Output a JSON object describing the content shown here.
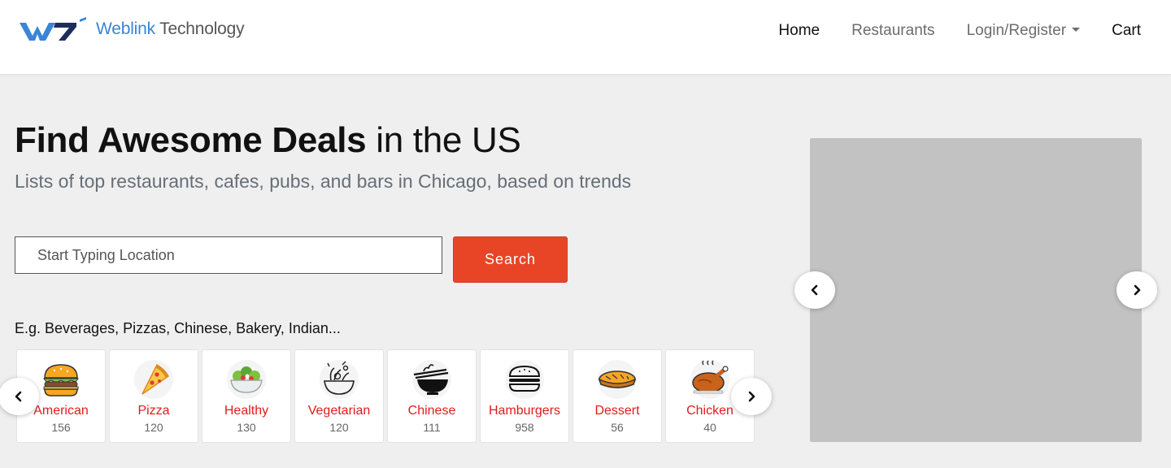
{
  "header": {
    "logo_mark": "W7",
    "logo_brand": "Weblink",
    "logo_rest": " Technology",
    "nav": {
      "home": "Home",
      "restaurants": "Restaurants",
      "login": "Login/Register",
      "cart": "Cart"
    }
  },
  "hero": {
    "title_bold": "Find Awesome Deals",
    "title_rest": " in the US",
    "subtitle": "Lists of top restaurants, cafes, pubs, and bars in Chicago, based on trends"
  },
  "search": {
    "placeholder": "Start Typing Location",
    "value": "",
    "button": "Search"
  },
  "examples": "E.g. Beverages, Pizzas, Chinese, Bakery, Indian...",
  "categories": [
    {
      "name": "American",
      "count": "156",
      "icon": "burger-icon"
    },
    {
      "name": "Pizza",
      "count": "120",
      "icon": "pizza-icon"
    },
    {
      "name": "Healthy",
      "count": "130",
      "icon": "salad-icon"
    },
    {
      "name": "Vegetarian",
      "count": "120",
      "icon": "vegetable-bowl-icon"
    },
    {
      "name": "Chinese",
      "count": "111",
      "icon": "noodle-bowl-icon"
    },
    {
      "name": "Hamburgers",
      "count": "958",
      "icon": "hamburger-outline-icon"
    },
    {
      "name": "Dessert",
      "count": "56",
      "icon": "pie-icon"
    },
    {
      "name": "Chicken",
      "count": "40",
      "icon": "roast-chicken-icon"
    }
  ],
  "colors": {
    "accent": "#e84527",
    "category_text": "#e01b1b",
    "brand_blue": "#3a85d6",
    "slider_bg": "#c2c2c2"
  }
}
